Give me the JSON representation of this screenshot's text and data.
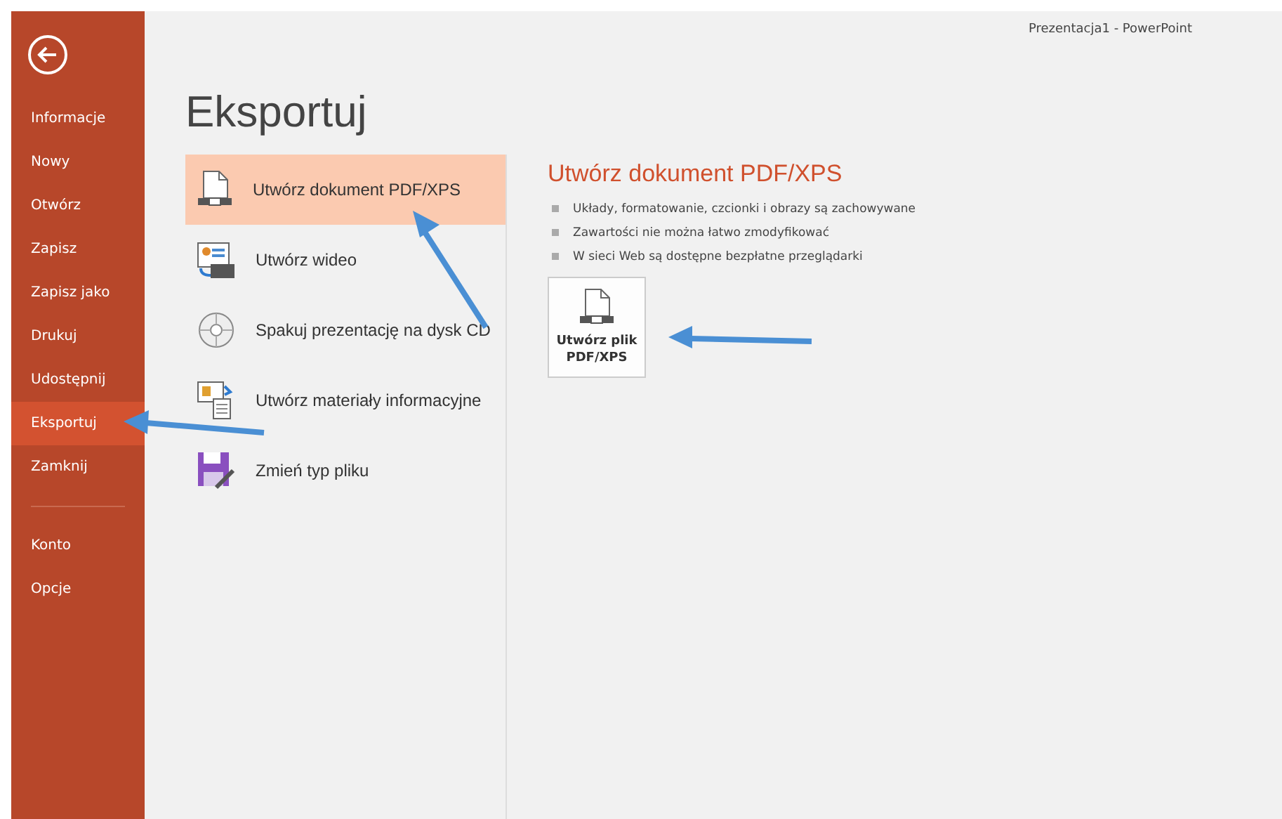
{
  "window": {
    "title": "Prezentacja1 - PowerPoint"
  },
  "sidebar": {
    "items": [
      {
        "label": "Informacje",
        "selected": false
      },
      {
        "label": "Nowy",
        "selected": false
      },
      {
        "label": "Otwórz",
        "selected": false
      },
      {
        "label": "Zapisz",
        "selected": false
      },
      {
        "label": "Zapisz jako",
        "selected": false
      },
      {
        "label": "Drukuj",
        "selected": false
      },
      {
        "label": "Udostępnij",
        "selected": false
      },
      {
        "label": "Eksportuj",
        "selected": true
      },
      {
        "label": "Zamknij",
        "selected": false
      }
    ],
    "footer_items": [
      {
        "label": "Konto",
        "selected": false
      },
      {
        "label": "Opcje",
        "selected": false
      }
    ]
  },
  "heading": "Eksportuj",
  "export_options": [
    {
      "kind": "pdf",
      "label": "Utwórz dokument PDF/XPS",
      "selected": true
    },
    {
      "kind": "video",
      "label": "Utwórz wideo",
      "selected": false
    },
    {
      "kind": "cd",
      "label": "Spakuj prezentację na dysk CD",
      "selected": false
    },
    {
      "kind": "handouts",
      "label": "Utwórz materiały informacyjne",
      "selected": false
    },
    {
      "kind": "filetype",
      "label": "Zmień typ pliku",
      "selected": false
    }
  ],
  "detail": {
    "title": "Utwórz dokument PDF/XPS",
    "bullets": [
      "Układy, formatowanie, czcionki i obrazy są zachowywane",
      "Zawartości nie można łatwo zmodyfikować",
      "W sieci Web są dostępne bezpłatne przeglądarki"
    ],
    "button": [
      "Utwórz plik",
      "PDF/XPS"
    ]
  }
}
